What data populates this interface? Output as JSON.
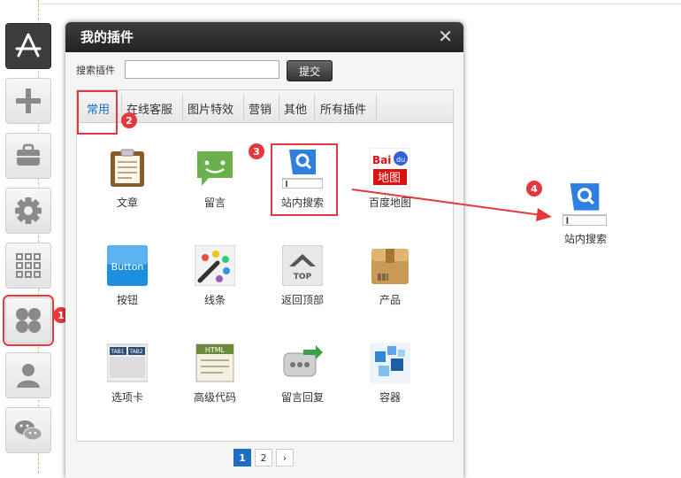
{
  "dialog": {
    "title": "我的插件",
    "close_symbol": "✕",
    "search_label": "搜索插件",
    "search_value": "",
    "submit_label": "提交"
  },
  "tabs": [
    "常用",
    "在线客服",
    "图片特效",
    "营销",
    "其他",
    "所有插件"
  ],
  "active_tab": "常用",
  "plugins": [
    {
      "label": "文章",
      "icon": "article-clipboard-icon"
    },
    {
      "label": "留言",
      "icon": "message-bubble-icon"
    },
    {
      "label": "站内搜索",
      "icon": "site-search-icon"
    },
    {
      "label": "百度地图",
      "icon": "baidu-map-icon"
    },
    {
      "label": "按钮",
      "icon": "button-icon"
    },
    {
      "label": "线条",
      "icon": "lines-palette-icon"
    },
    {
      "label": "返回顶部",
      "icon": "back-to-top-icon"
    },
    {
      "label": "产品",
      "icon": "product-box-icon"
    },
    {
      "label": "选项卡",
      "icon": "tabs-icon"
    },
    {
      "label": "高级代码",
      "icon": "html-code-icon"
    },
    {
      "label": "留言回复",
      "icon": "message-reply-icon"
    },
    {
      "label": "容器",
      "icon": "container-cubes-icon"
    }
  ],
  "icon_text": {
    "button": "Button",
    "baidu_top": "Bai",
    "baidu_du": "du",
    "baidu_bottom": "地图",
    "top": "TOP",
    "tab1": "TAB1",
    "tab2": "TAB2",
    "html": "HTML"
  },
  "pagination": {
    "pages": [
      "1",
      "2"
    ],
    "current": "1",
    "next_symbol": "›"
  },
  "sidebar": [
    "app-store-icon",
    "plus-icon",
    "toolbox-icon",
    "gear-icon",
    "grid-icon",
    "plugins-icon",
    "user-icon",
    "wechat-icon"
  ],
  "badges": [
    "1",
    "2",
    "3",
    "4"
  ],
  "dropped_widget": {
    "label": "站内搜索"
  },
  "colors": {
    "highlight": "#e4393c",
    "accent": "#1c6fc2",
    "search_blue": "#2f7fe3"
  }
}
